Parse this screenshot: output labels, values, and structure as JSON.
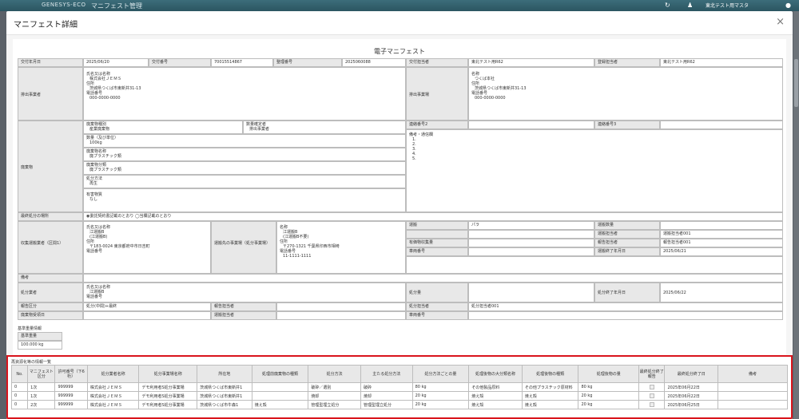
{
  "app": {
    "logo": "GENESYS-ECO",
    "title": "マニフェスト管理",
    "user": "東北テスト用マスタ"
  },
  "modal": {
    "title": "マニフェスト詳細",
    "close": "×"
  },
  "doc": {
    "title": "電子マニフェスト",
    "l_kofu_date": "交付年月日",
    "kofu_date": "2025/06/20",
    "l_kofu_no": "交付番号",
    "kofu_no": "70015514867",
    "l_seiri_no": "整理番号",
    "seiri_no": "2025060088",
    "l_kofu_tanto": "交付担当者",
    "kofu_tanto": "東北テスト用R62",
    "l_toroku_tanto": "登録担当者",
    "toroku_tanto": "東北テスト用R62",
    "l_haishutsu": "排出事業者",
    "haishutsu": {
      "l_name": "氏名又は名称",
      "name": "株式会社ＪＥＭＳ",
      "l_addr": "住所",
      "addr": "茨城県つくば市東新井31-13",
      "l_tel": "電話番号",
      "tel": "000-0000-0000"
    },
    "l_jigyojo": "排出事業場",
    "jigyojo": {
      "l_name": "名称",
      "name": "つくば本社",
      "l_addr": "住所",
      "addr": "茨城県つくば市東新井31-13",
      "l_tel": "電話番号",
      "tel": "000-0000-0000"
    },
    "l_haikibutsu": "廃棄物",
    "w": {
      "l_shubetsu": "廃棄物種別",
      "shubetsu": "産業廃棄物",
      "l_kakutei": "数量確定者",
      "kakutei": "排出事業者",
      "l_suryo": "数量（及び単位）",
      "suryo": "100kg",
      "l_meisho": "廃棄物名称",
      "meisho": "廃プラスチック類",
      "l_bunrui": "廃棄物分類",
      "bunrui": "廃プラスチック類",
      "l_hoho": "処分方法",
      "hoho": "再生",
      "l_yugai": "有害物質",
      "yugai": "なし"
    },
    "l_renraku2": "連絡番号2",
    "l_renraku3": "連絡番号3",
    "l_biko_tsushin": "備考・通信欄",
    "biko_items": [
      "1.",
      "2.",
      "3.",
      "4.",
      "5."
    ],
    "l_saishu": "最終処分の場所",
    "saishu": "◉委託契約書記載のとおり ◯当欄記載のとおり",
    "l_unpan": "収集運搬業者（区間1）",
    "unpan": {
      "l_name": "氏名又は名称",
      "name1": "江運搬B",
      "name2": "(江運搬B)",
      "l_addr": "住所",
      "addr": "〒183-0024 東京都府中市日吉町",
      "l_tel": "電話番号"
    },
    "l_unpan_saki": "運搬先の事業場（処分事業場）",
    "unpan_saki": {
      "l_name": "名称",
      "name1": "江運搬B",
      "name2": "(江運搬B不要)",
      "l_addr": "住所",
      "addr": "〒270-1321 千葉県印西市相崎",
      "l_tel": "電話番号",
      "tel": "11-1111-1111"
    },
    "l_shudan": "運搬",
    "shudan": "パラ",
    "l_unpan_suryo": "運搬数量",
    "l_yuka_suryo": "有価物収集量",
    "l_sharyo": "車両番号",
    "l_unpan_tanto": "運搬担当者",
    "unpan_tanto": "運搬担当者001",
    "l_hokoku_tanto": "報告担当者",
    "hokoku_tanto": "報告担当者001",
    "l_unpan_end": "運搬終了年月日",
    "unpan_end": "2025/06/21",
    "l_biko": "備考",
    "l_shobun_gyosha": "処分業者",
    "shobun": {
      "l_name": "氏名又は名称",
      "name": "江運搬B",
      "l_tel": "電話番号"
    },
    "l_shobun_ryo": "処分量",
    "l_shobun_end": "処分終了年月日",
    "shobun_end": "2025/06/22",
    "l_hokoku_kubun": "報告区分",
    "hokoku_kubun": "処分(中間)+最終",
    "l_hokoku_tanto2": "報告担当者",
    "l_shobun_tanto": "処分担当者",
    "shobun_tanto": "処分担当者001",
    "l_juryo": "廃棄物受領日",
    "l_unpan_tanto2": "運搬担当者",
    "l_sharyo2": "車両番号"
  },
  "std": {
    "title": "基準重量情報",
    "l_weight": "基準重量",
    "weight": "100.000 kg"
  },
  "rec": {
    "title": "再資源化等の情報一覧",
    "headers": [
      "No.",
      "マニフェスト区分",
      "許可番号（下6桁）",
      "処分業者名称",
      "処分事業場名称",
      "所在地",
      "処理前廃棄物の種類",
      "処分方法",
      "主たる処分方法",
      "処分方法ごとの量",
      "処理後物の大分類名称",
      "処理後物の種類",
      "処理後物の量",
      "最終処分終了報告",
      "最終処分終了日",
      "備考"
    ],
    "rows": [
      [
        "0",
        "1次",
        "999999",
        "株式会社ＪＥＭＳ",
        "デモ利用者S処分事業場",
        "茨城県つくば市東新井1",
        "",
        "破砕／選別",
        "破砕",
        "80 kg",
        "その他製品原料",
        "その他プラスチック原材料",
        "80 kg",
        "",
        "2025年06月22日",
        ""
      ],
      [
        "0",
        "1次",
        "999999",
        "株式会社ＪＥＭＳ",
        "デモ利用者S処分事業場",
        "茨城県つくば市東新井1",
        "",
        "焼却",
        "焼却",
        "20 kg",
        "焼え殻",
        "焼え殻",
        "20 kg",
        "",
        "2025年06月22日",
        ""
      ],
      [
        "0",
        "2次",
        "999999",
        "株式会社ＪＥＭＳ",
        "デモ利用者S処分事業場",
        "茨城県つくば市牛森1",
        "焼え殻",
        "管理型埋立処分",
        "管理型埋立処分",
        "20 kg",
        "焼え殻",
        "焼え殻",
        "20 kg",
        "",
        "2025年06月25日",
        ""
      ]
    ]
  }
}
